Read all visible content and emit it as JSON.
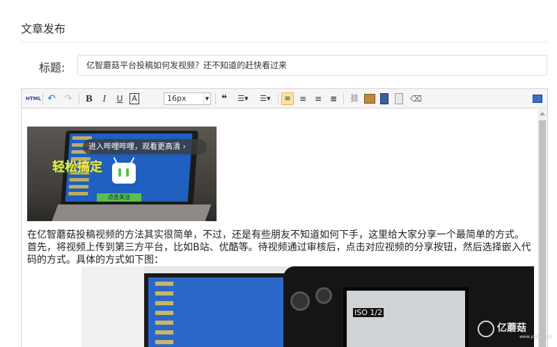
{
  "page": {
    "title": "文章发布"
  },
  "form": {
    "title_label": "标题:",
    "title_value": "亿智蘑菇平台投稿如何发视频？还不知道的赶快看过来"
  },
  "toolbar": {
    "html": "HTML",
    "bold": "B",
    "italic": "I",
    "underline": "U",
    "fontcolor": "A",
    "fontsize_value": "16px",
    "quote": "66"
  },
  "video": {
    "overlay_text": "进入哔哩哔哩，观看更高清 ›",
    "screen_big_text": "轻松搞定",
    "screen_bar_text": "点击关注"
  },
  "article": {
    "paragraph": "在亿智蘑菇投稿视频的方法其实很简单，不过，还是有些朋友不知道如何下手，这里给大家分享一个最简单的方式。首先，将视频上传到第三方平台，比如B站、优酷等。待视频通过审核后，点击对应视频的分享按钮，然后选择嵌入代码的方式。具体的方式如下图："
  },
  "photo": {
    "iso_text": "ISO 1/2"
  },
  "watermark": {
    "text": "亿蘑菇",
    "url": "www.yzmg.com"
  },
  "colors": {
    "accent": "#fbe3a4",
    "border": "#d4d4d4"
  }
}
